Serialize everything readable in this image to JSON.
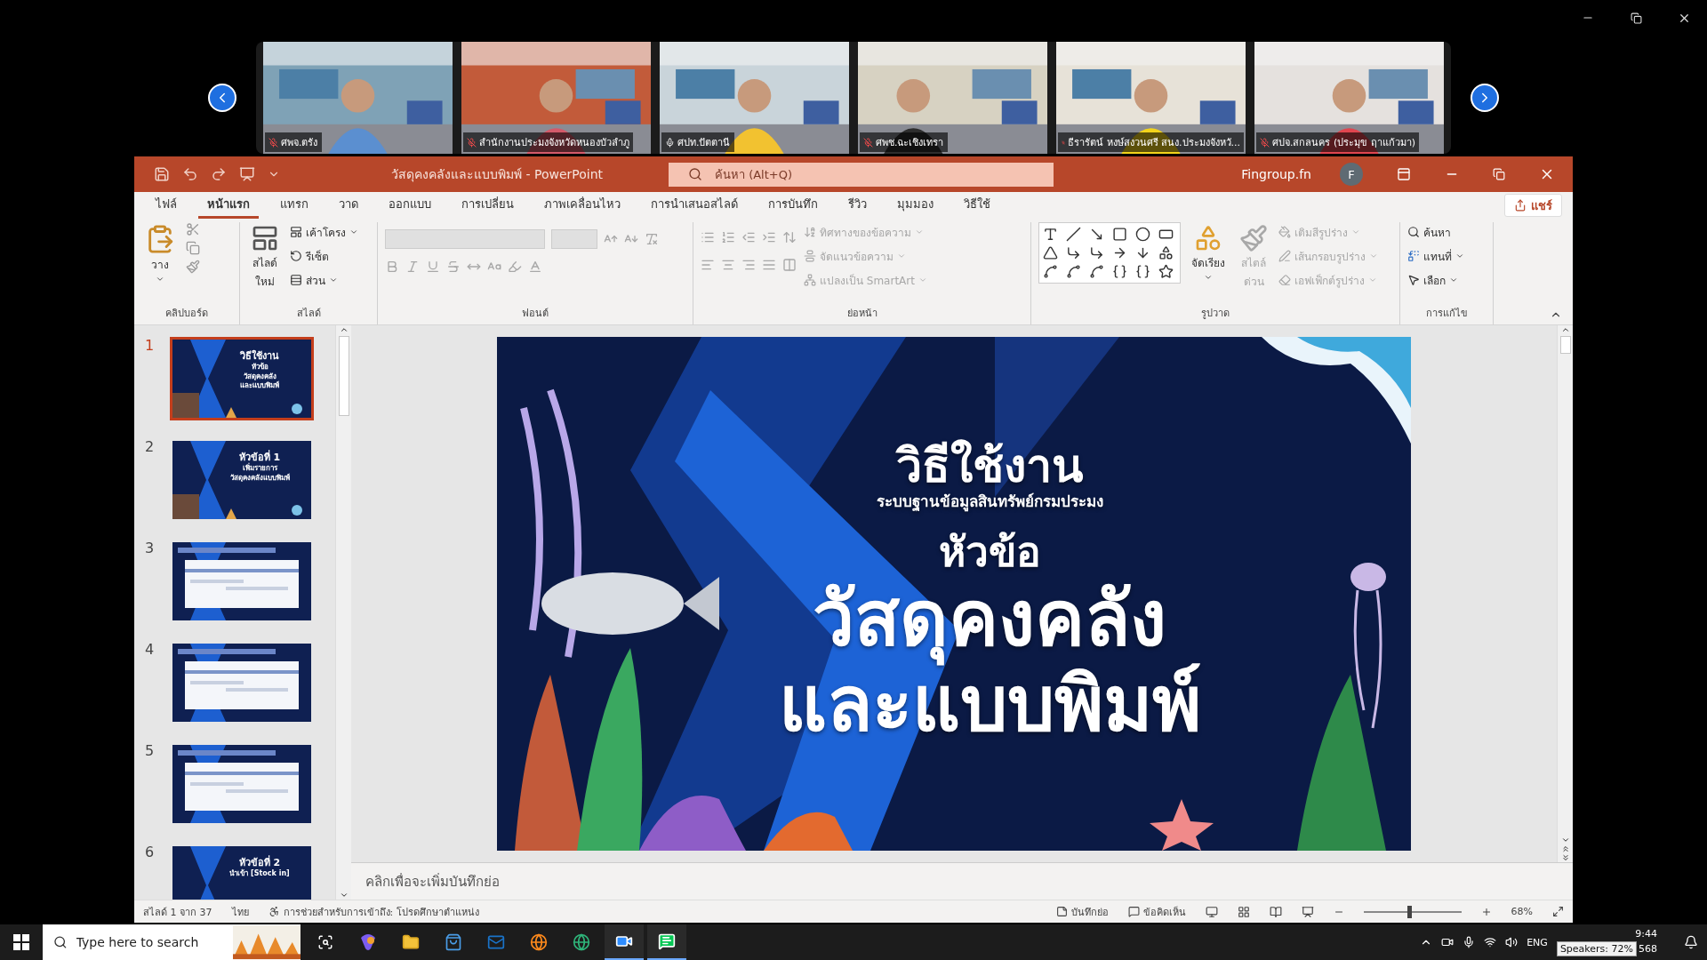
{
  "meeting": {
    "participants": [
      {
        "name": "ศพจ.ตรัง",
        "muted": true
      },
      {
        "name": "สำนักงานประมงจังหวัดหนองบัวลำภู",
        "muted": true
      },
      {
        "name": "ศปท.ปัตตานี",
        "muted": false
      },
      {
        "name": "ศพช.ฉะเชิงเทรา",
        "muted": true
      },
      {
        "name": "ธีรารัตน์  หงษ์สงวนศรี สนง.ประมงจังหวั...",
        "muted": true
      },
      {
        "name": "ศปจ.สกลนคร (ประมุข ฤาแก้วมา)",
        "muted": true
      }
    ]
  },
  "window": {
    "title": "วัสดุคงคลังและแบบพิมพ์  -  PowerPoint",
    "search_placeholder": "ค้นหา (Alt+Q)",
    "user": "Fingroup.fn",
    "avatar": "F"
  },
  "tabs": [
    {
      "label": "ไฟล์",
      "selected": false
    },
    {
      "label": "หน้าแรก",
      "selected": true
    },
    {
      "label": "แทรก",
      "selected": false
    },
    {
      "label": "วาด",
      "selected": false
    },
    {
      "label": "ออกแบบ",
      "selected": false
    },
    {
      "label": "การเปลี่ยน",
      "selected": false
    },
    {
      "label": "ภาพเคลื่อนไหว",
      "selected": false
    },
    {
      "label": "การนำเสนอสไลด์",
      "selected": false
    },
    {
      "label": "การบันทึก",
      "selected": false
    },
    {
      "label": "รีวิว",
      "selected": false
    },
    {
      "label": "มุมมอง",
      "selected": false
    },
    {
      "label": "วิธีใช้",
      "selected": false
    }
  ],
  "share_button": "แชร์",
  "ribbon": {
    "clipboard": {
      "title": "คลิปบอร์ด",
      "paste": "วาง"
    },
    "slides": {
      "title": "สไลด์",
      "new_slide": [
        "สไลด์",
        "ใหม่"
      ],
      "layout": "เค้าโครง",
      "reset": "รีเซ็ต",
      "section": "ส่วน"
    },
    "font": {
      "title": "ฟอนต์",
      "disabled": true
    },
    "paragraph": {
      "title": "ย่อหน้า",
      "disabled": true,
      "text_direction": "ทิศทางของข้อความ",
      "align_text": "จัดแนวข้อความ",
      "smartart": "แปลงเป็น SmartArt"
    },
    "drawing": {
      "title": "รูปวาด",
      "arrange": "จัดเรียง",
      "quick_styles": {
        "lines": [
          "สไตล์",
          "ด่วน"
        ],
        "disabled": true
      },
      "rows": [
        {
          "label": "เติมสีรูปร่าง",
          "disabled": true
        },
        {
          "label": "เส้นกรอบรูปร่าง",
          "disabled": true
        },
        {
          "label": "เอฟเฟ็กต์รูปร่าง",
          "disabled": true
        }
      ]
    },
    "editing": {
      "title": "การแก้ไข",
      "find": "ค้นหา",
      "replace": "แทนที่",
      "select": "เลือก"
    }
  },
  "thumbnails": [
    {
      "number": "1",
      "selected": true,
      "lines": [
        "วิธีใช้งาน",
        "หัวข้อ",
        "วัสดุคงคลัง",
        "และแบบพิมพ์"
      ]
    },
    {
      "number": "2",
      "selected": false,
      "lines": [
        "หัวข้อที่ 1",
        "เพิ่มรายการ",
        "วัสดุคงคลังแบบพิมพ์"
      ]
    },
    {
      "number": "3",
      "selected": false
    },
    {
      "number": "4",
      "selected": false
    },
    {
      "number": "5",
      "selected": false
    },
    {
      "number": "6",
      "selected": false,
      "lines": [
        "หัวข้อที่ 2",
        "นำเข้า [Stock in]"
      ]
    }
  ],
  "slide": {
    "lines": [
      {
        "kind": "heading",
        "text": "วิธีใช้งาน"
      },
      {
        "kind": "subtitle",
        "text": "ระบบฐานข้อมูลสินทรัพย์กรมประมง"
      },
      {
        "kind": "topic",
        "text": "หัวข้อ"
      },
      {
        "kind": "title",
        "text": "วัสดุคงคลัง"
      },
      {
        "kind": "title",
        "text": "และแบบพิมพ์"
      }
    ]
  },
  "notes": {
    "placeholder": "คลิกเพื่อจะเพิ่มบันทึกย่อ"
  },
  "status_bar": {
    "slide_counter": "สไลด์ 1 จาก 37",
    "language": "ไทย",
    "accessibility": "การช่วยสำหรับการเข้าถึง: โปรดศึกษาตำแหน่ง",
    "notes": "บันทึกย่อ",
    "comments": "ข้อคิดเห็น",
    "zoom": {
      "level": 0.45,
      "reading": "68%"
    }
  },
  "taskbar": {
    "search_placeholder": "Type here to search",
    "language": "ENG",
    "clock": "9:44",
    "tooltip": "Speakers: 72%",
    "date_fragment": "568"
  }
}
